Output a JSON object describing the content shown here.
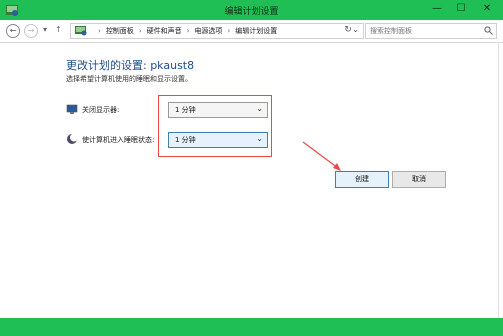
{
  "window": {
    "title": "编辑计划设置",
    "minimize_glyph": "—",
    "maximize_glyph": "☐",
    "close_glyph": "✕"
  },
  "nav": {
    "back_glyph": "←",
    "forward_glyph": "→",
    "dropdown_glyph": "▾",
    "up_glyph": "↑",
    "breadcrumbs": [
      "控制面板",
      "硬件和声音",
      "电源选项",
      "编辑计划设置"
    ],
    "breadcrumb_separator": "›",
    "address_dropdown_glyph": "⌄",
    "refresh_glyph": "↻",
    "search_placeholder": "搜索控制面板"
  },
  "main": {
    "heading": "更改计划的设置: pkaust8",
    "subtext": "选择希望计算机使用的睡眠和显示设置。",
    "settings": [
      {
        "label": "关闭显示器:",
        "value": "1 分钟",
        "icon": "monitor-icon"
      },
      {
        "label": "使计算机进入睡眠状态:",
        "value": "1 分钟",
        "icon": "moon-icon"
      }
    ],
    "select_arrow_glyph": "⌄",
    "buttons": {
      "create": "创建",
      "cancel": "取消"
    }
  },
  "colors": {
    "titlebar": "#1fbf55",
    "heading": "#1e4f8a",
    "annotation": "#e84a4a"
  }
}
